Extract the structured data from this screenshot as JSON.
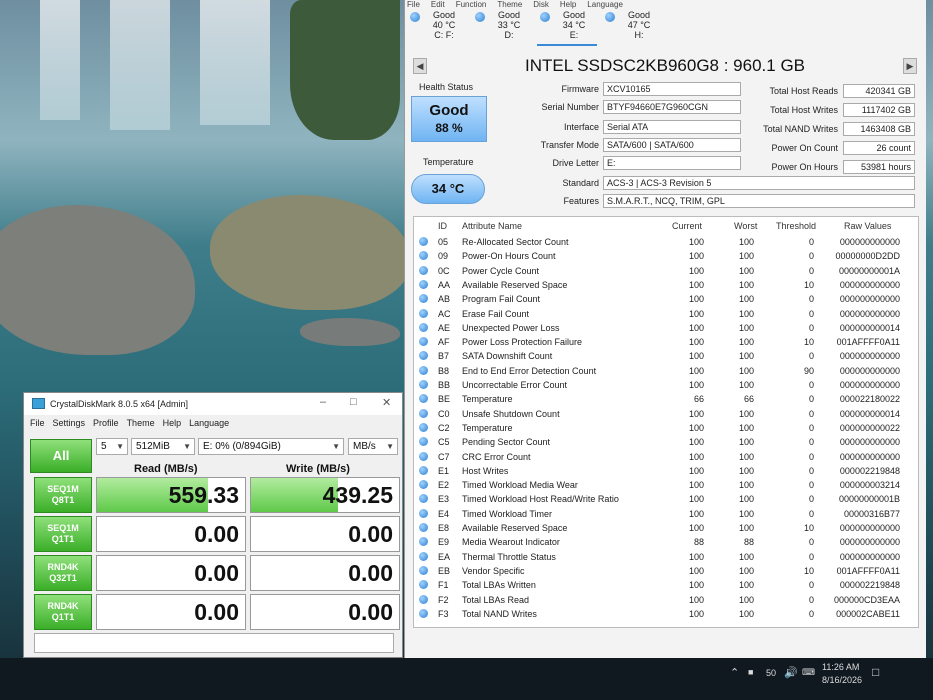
{
  "desktop": {
    "taskbar": {
      "time": "11:26 AM",
      "date": "8/16/2026",
      "volume": "50"
    }
  },
  "cdi": {
    "menu": [
      "File",
      "Edit",
      "Function",
      "Theme",
      "Disk",
      "Help",
      "Language"
    ],
    "disk_tabs": [
      {
        "status": "Good",
        "temp": "40 °C",
        "drive": "C: F:"
      },
      {
        "status": "Good",
        "temp": "33 °C",
        "drive": "D:"
      },
      {
        "status": "Good",
        "temp": "34 °C",
        "drive": "E:"
      },
      {
        "status": "Good",
        "temp": "47 °C",
        "drive": "H:"
      }
    ],
    "title": "INTEL SSDSC2KB960G8 : 960.1 GB",
    "health_label": "Health Status",
    "health_status": "Good",
    "health_percent": "88 %",
    "temp_label": "Temperature",
    "temp_value": "34 °C",
    "labels": {
      "firmware": "Firmware",
      "serial": "Serial Number",
      "interface": "Interface",
      "transfer": "Transfer Mode",
      "drive_letter": "Drive Letter",
      "standard": "Standard",
      "features": "Features",
      "host_reads": "Total Host Reads",
      "host_writes": "Total Host Writes",
      "nand_writes": "Total NAND Writes",
      "power_count": "Power On Count",
      "power_hours": "Power On Hours"
    },
    "values": {
      "firmware": "XCV10165",
      "serial": "BTYF94660E7G960CGN",
      "interface": "Serial ATA",
      "transfer": "SATA/600 | SATA/600",
      "drive_letter": "E:",
      "standard": "ACS-3 | ACS-3 Revision 5",
      "features": "S.M.A.R.T., NCQ, TRIM, GPL",
      "host_reads": "420341 GB",
      "host_writes": "1117402 GB",
      "nand_writes": "1463408 GB",
      "power_count": "26 count",
      "power_hours": "53981 hours"
    },
    "smart_headers": [
      "ID",
      "Attribute Name",
      "Current",
      "Worst",
      "Threshold",
      "Raw Values"
    ],
    "smart_rows": [
      [
        "05",
        "Re-Allocated Sector Count",
        "100",
        "100",
        "0",
        "000000000000"
      ],
      [
        "09",
        "Power-On Hours Count",
        "100",
        "100",
        "0",
        "00000000D2DD"
      ],
      [
        "0C",
        "Power Cycle Count",
        "100",
        "100",
        "0",
        "00000000001A"
      ],
      [
        "AA",
        "Available Reserved Space",
        "100",
        "100",
        "10",
        "000000000000"
      ],
      [
        "AB",
        "Program Fail Count",
        "100",
        "100",
        "0",
        "000000000000"
      ],
      [
        "AC",
        "Erase Fail Count",
        "100",
        "100",
        "0",
        "000000000000"
      ],
      [
        "AE",
        "Unexpected Power Loss",
        "100",
        "100",
        "0",
        "000000000014"
      ],
      [
        "AF",
        "Power Loss Protection Failure",
        "100",
        "100",
        "10",
        "001AFFFF0A11"
      ],
      [
        "B7",
        "SATA Downshift Count",
        "100",
        "100",
        "0",
        "000000000000"
      ],
      [
        "B8",
        "End to End Error Detection Count",
        "100",
        "100",
        "90",
        "000000000000"
      ],
      [
        "BB",
        "Uncorrectable Error Count",
        "100",
        "100",
        "0",
        "000000000000"
      ],
      [
        "BE",
        "Temperature",
        "66",
        "66",
        "0",
        "000022180022"
      ],
      [
        "C0",
        "Unsafe Shutdown Count",
        "100",
        "100",
        "0",
        "000000000014"
      ],
      [
        "C2",
        "Temperature",
        "100",
        "100",
        "0",
        "000000000022"
      ],
      [
        "C5",
        "Pending Sector Count",
        "100",
        "100",
        "0",
        "000000000000"
      ],
      [
        "C7",
        "CRC Error Count",
        "100",
        "100",
        "0",
        "000000000000"
      ],
      [
        "E1",
        "Host Writes",
        "100",
        "100",
        "0",
        "000002219848"
      ],
      [
        "E2",
        "Timed Workload Media Wear",
        "100",
        "100",
        "0",
        "000000003214"
      ],
      [
        "E3",
        "Timed Workload Host Read/Write Ratio",
        "100",
        "100",
        "0",
        "00000000001B"
      ],
      [
        "E4",
        "Timed Workload Timer",
        "100",
        "100",
        "0",
        "00000316B77"
      ],
      [
        "E8",
        "Available Reserved Space",
        "100",
        "100",
        "10",
        "000000000000"
      ],
      [
        "E9",
        "Media Wearout Indicator",
        "88",
        "88",
        "0",
        "000000000000"
      ],
      [
        "EA",
        "Thermal Throttle Status",
        "100",
        "100",
        "0",
        "000000000000"
      ],
      [
        "EB",
        "Vendor Specific",
        "100",
        "100",
        "10",
        "001AFFFF0A11"
      ],
      [
        "F1",
        "Total LBAs Written",
        "100",
        "100",
        "0",
        "000002219848"
      ],
      [
        "F2",
        "Total LBAs Read",
        "100",
        "100",
        "0",
        "000000CD3EAA"
      ],
      [
        "F3",
        "Total NAND Writes",
        "100",
        "100",
        "0",
        "000002CABE11"
      ]
    ]
  },
  "cdm": {
    "title": "CrystalDiskMark 8.0.5 x64 [Admin]",
    "menu": [
      "File",
      "Settings",
      "Profile",
      "Theme",
      "Help",
      "Language"
    ],
    "all_button": "All",
    "count": "5",
    "size": "512MiB",
    "drive": "E: 0% (0/894GiB)",
    "unit": "MB/s",
    "read_header": "Read (MB/s)",
    "write_header": "Write (MB/s)",
    "tests": [
      {
        "line1": "SEQ1M",
        "line2": "Q8T1",
        "read": "559.33",
        "write": "439.25",
        "read_fill": 0.75,
        "write_fill": 0.59
      },
      {
        "line1": "SEQ1M",
        "line2": "Q1T1",
        "read": "0.00",
        "write": "0.00",
        "read_fill": 0,
        "write_fill": 0
      },
      {
        "line1": "RND4K",
        "line2": "Q32T1",
        "read": "0.00",
        "write": "0.00",
        "read_fill": 0,
        "write_fill": 0
      },
      {
        "line1": "RND4K",
        "line2": "Q1T1",
        "read": "0.00",
        "write": "0.00",
        "read_fill": 0,
        "write_fill": 0
      }
    ],
    "comment": ""
  }
}
